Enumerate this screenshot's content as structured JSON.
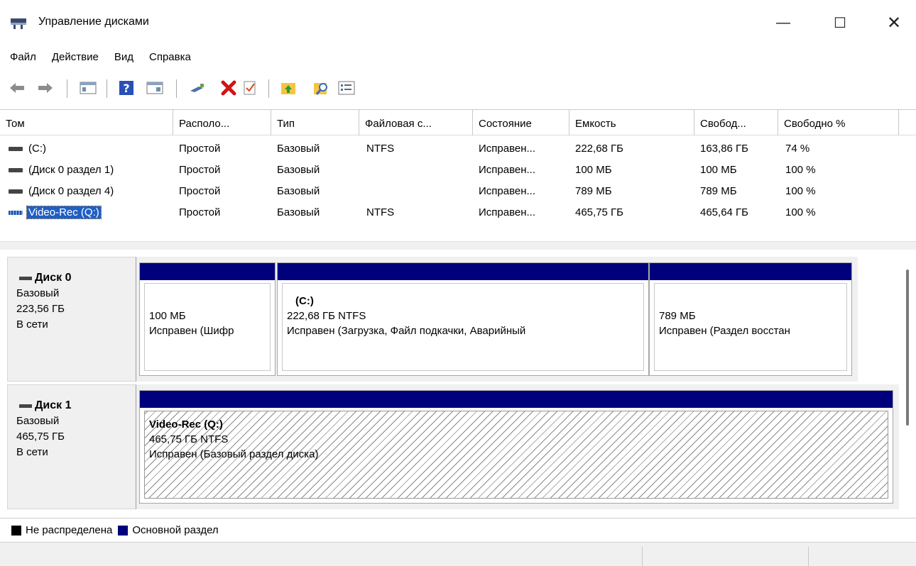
{
  "window": {
    "title": "Управление дисками",
    "minimize": "—",
    "maximize": "☐",
    "close": "✕"
  },
  "menu": [
    "Файл",
    "Действие",
    "Вид",
    "Справка"
  ],
  "toolbar": {
    "icons": [
      "back-arrow-icon",
      "forward-arrow-icon",
      "console-tree-icon",
      "help-icon",
      "action-pane-icon",
      "connect-drive-icon",
      "delete-icon",
      "checkmark-icon",
      "folder-up-icon",
      "search-folder-icon",
      "properties-icon"
    ]
  },
  "volumes": {
    "headers": [
      "Том",
      "Располо...",
      "Тип",
      "Файловая с...",
      "Состояние",
      "Емкость",
      "Свобод...",
      "Свободно %"
    ],
    "rows": [
      {
        "name": "(C:)",
        "layout": "Простой",
        "type": "Базовый",
        "fs": "NTFS",
        "status": "Исправен...",
        "capacity": "222,68 ГБ",
        "free": "163,86 ГБ",
        "free_pct": "74 %"
      },
      {
        "name": "(Диск 0 раздел 1)",
        "layout": "Простой",
        "type": "Базовый",
        "fs": "",
        "status": "Исправен...",
        "capacity": "100 МБ",
        "free": "100 МБ",
        "free_pct": "100 %"
      },
      {
        "name": "(Диск 0 раздел 4)",
        "layout": "Простой",
        "type": "Базовый",
        "fs": "",
        "status": "Исправен...",
        "capacity": "789 МБ",
        "free": "789 МБ",
        "free_pct": "100 %"
      },
      {
        "name": "Video-Rec (Q:)",
        "layout": "Простой",
        "type": "Базовый",
        "fs": "NTFS",
        "status": "Исправен...",
        "capacity": "465,75 ГБ",
        "free": "465,64 ГБ",
        "free_pct": "100 %"
      }
    ]
  },
  "disks": [
    {
      "name": "Диск 0",
      "type": "Базовый",
      "size": "223,56 ГБ",
      "state": "В сети",
      "partitions": [
        {
          "title": "",
          "size": "100 МБ",
          "status": "Исправен (Шифр"
        },
        {
          "title": "(C:)",
          "size": "222,68 ГБ NTFS",
          "status": "Исправен (Загрузка, Файл подкачки, Аварийный"
        },
        {
          "title": "",
          "size": "789 МБ",
          "status": "Исправен (Раздел восстан"
        }
      ]
    },
    {
      "name": "Диск 1",
      "type": "Базовый",
      "size": "465,75 ГБ",
      "state": "В сети",
      "partitions": [
        {
          "title": "Video-Rec  (Q:)",
          "size": "465,75 ГБ NTFS",
          "status": "Исправен (Базовый раздел диска)"
        }
      ]
    }
  ],
  "legend": [
    {
      "label": "Не распределена",
      "color": "#000000"
    },
    {
      "label": "Основной раздел",
      "color": "#00007c"
    }
  ],
  "colors": {
    "partition_bar": "#00007c",
    "selection": "#1e5fc6"
  }
}
